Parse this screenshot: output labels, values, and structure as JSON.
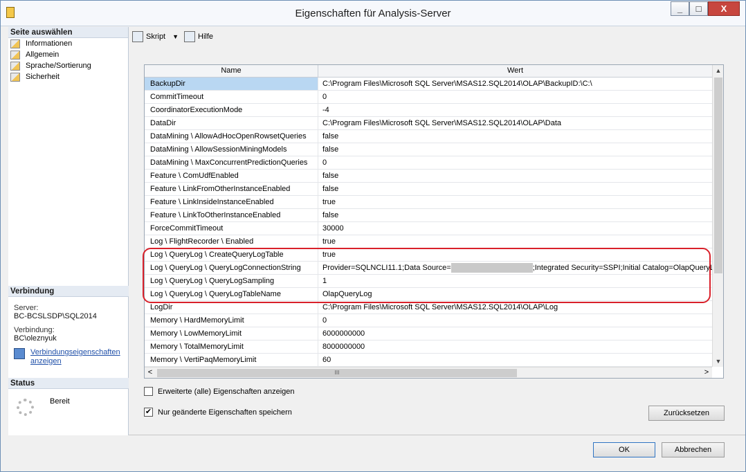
{
  "window": {
    "title": "Eigenschaften für Analysis-Server",
    "minimize": "_",
    "maximize": "□",
    "close": "X"
  },
  "left": {
    "select_page_header": "Seite auswählen",
    "pages": [
      {
        "label": "Informationen"
      },
      {
        "label": "Allgemein"
      },
      {
        "label": "Sprache/Sortierung"
      },
      {
        "label": "Sicherheit"
      }
    ],
    "connection_header": "Verbindung",
    "server_label": "Server:",
    "server_value": "BC-BCSLSDP\\SQL2014",
    "connection_label": "Verbindung:",
    "connection_value": "BC\\oleznyuk",
    "view_props_link_line1": "Verbindungseigenschaften",
    "view_props_link_line2": "anzeigen",
    "status_header": "Status",
    "status_value": "Bereit"
  },
  "toolbar": {
    "script_label": "Skript",
    "script_arrow": "▼",
    "help_label": "Hilfe"
  },
  "grid": {
    "col_name": "Name",
    "col_value": "Wert",
    "rows": [
      {
        "name": "BackupDir",
        "value": "C:\\Program Files\\Microsoft SQL Server\\MSAS12.SQL2014\\OLAP\\BackupID:\\C:\\"
      },
      {
        "name": "CommitTimeout",
        "value": "0"
      },
      {
        "name": "CoordinatorExecutionMode",
        "value": "-4"
      },
      {
        "name": "DataDir",
        "value": "C:\\Program Files\\Microsoft SQL Server\\MSAS12.SQL2014\\OLAP\\Data"
      },
      {
        "name": "DataMining \\ AllowAdHocOpenRowsetQueries",
        "value": "false"
      },
      {
        "name": "DataMining \\ AllowSessionMiningModels",
        "value": "false"
      },
      {
        "name": "DataMining \\ MaxConcurrentPredictionQueries",
        "value": "0"
      },
      {
        "name": "Feature \\ ComUdfEnabled",
        "value": "false"
      },
      {
        "name": "Feature \\ LinkFromOtherInstanceEnabled",
        "value": "false"
      },
      {
        "name": "Feature \\ LinkInsideInstanceEnabled",
        "value": "true"
      },
      {
        "name": "Feature \\ LinkToOtherInstanceEnabled",
        "value": "false"
      },
      {
        "name": "ForceCommitTimeout",
        "value": "30000"
      },
      {
        "name": "Log \\ FlightRecorder \\ Enabled",
        "value": "true"
      },
      {
        "name": "Log \\ QueryLog \\ CreateQueryLogTable",
        "value": "true"
      },
      {
        "name": "Log \\ QueryLog \\ QueryLogConnectionString",
        "value": "Provider=SQLNCLI11.1;Data Source=",
        "value_after_mask": ";Integrated Security=SSPI;Initial Catalog=OlapQueryLog"
      },
      {
        "name": "Log \\ QueryLog \\ QueryLogSampling",
        "value": "1"
      },
      {
        "name": "Log \\ QueryLog \\ QueryLogTableName",
        "value": "OlapQueryLog"
      },
      {
        "name": "LogDir",
        "value": "C:\\Program Files\\Microsoft SQL Server\\MSAS12.SQL2014\\OLAP\\Log"
      },
      {
        "name": "Memory \\ HardMemoryLimit",
        "value": "0"
      },
      {
        "name": "Memory \\ LowMemoryLimit",
        "value": "6000000000"
      },
      {
        "name": "Memory \\ TotalMemoryLimit",
        "value": "8000000000"
      },
      {
        "name": "Memory \\ VertiPaqMemoryLimit",
        "value": "60"
      }
    ],
    "hscroll_grip": "III",
    "scroll_up": "▲",
    "scroll_down": "▼",
    "scroll_left": "<",
    "scroll_right": ">"
  },
  "options": {
    "show_advanced_label": "Erweiterte (alle) Eigenschaften anzeigen",
    "show_advanced_checked": false,
    "save_changed_only_label": "Nur geänderte Eigenschaften speichern",
    "save_changed_only_checked": true,
    "checkmark": "✔"
  },
  "buttons": {
    "reset": "Zurücksetzen",
    "ok": "OK",
    "cancel": "Abbrechen"
  },
  "colors": {
    "highlight_outline": "#d9202a",
    "selected_row": "#b9d7f2",
    "link": "#1f4fa8"
  }
}
